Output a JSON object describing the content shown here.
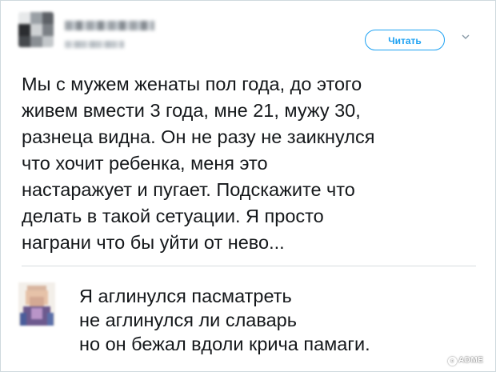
{
  "tweet": {
    "follow_label": "Читать",
    "text_lines": [
      "Мы с мужем женаты пол года, до этого",
      "живем вмести 3 года, мне 21, мужу 30,",
      "разнеца видна. Он не разу не заикнулся",
      "что хочит ребенка, меня это",
      "настаражует и пугает. Подскажите что",
      "делать в такой сетуации. Я просто",
      "награни что бы уйти от нево..."
    ]
  },
  "reply": {
    "text_lines": [
      "Я аглинулся пасматреть",
      "не аглинулся ли славарь",
      "но он бежал вдоли крича памаги."
    ]
  },
  "watermark": {
    "symbol": "c",
    "text": "ADME"
  },
  "icons": {
    "author_avatar": "blurred-avatar",
    "caret": "chevron-down-icon",
    "reply_avatar": "blurred-avatar"
  },
  "colors": {
    "accent": "#1da1f2",
    "text": "#14171a",
    "divider": "#d6dbdf"
  }
}
